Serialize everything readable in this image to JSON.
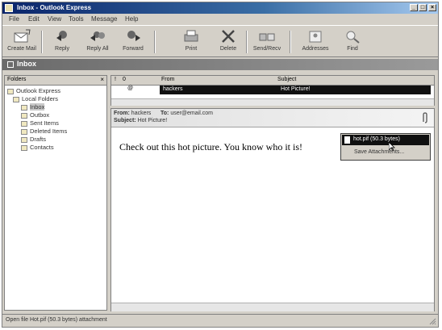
{
  "window": {
    "title": "Inbox - Outlook Express",
    "close_glyph": "×",
    "minimize_glyph": "_",
    "maximize_glyph": "□"
  },
  "menu": [
    "File",
    "Edit",
    "View",
    "Tools",
    "Message",
    "Help"
  ],
  "toolbar": [
    {
      "label": "Create Mail",
      "icon": "create-mail-icon"
    },
    {
      "label": "Reply",
      "icon": "reply-icon"
    },
    {
      "label": "Reply All",
      "icon": "reply-all-icon"
    },
    {
      "label": "Forward",
      "icon": "forward-icon"
    },
    {
      "label": "Print",
      "icon": "print-icon"
    },
    {
      "label": "Delete",
      "icon": "delete-icon"
    },
    {
      "label": "Send/Recv",
      "icon": "send-receive-icon"
    },
    {
      "label": "Addresses",
      "icon": "addresses-icon"
    },
    {
      "label": "Find",
      "icon": "find-icon"
    }
  ],
  "folder_bar": {
    "title": "Inbox"
  },
  "folders": {
    "header": "Folders",
    "close": "×",
    "items": [
      {
        "label": "Outlook Express",
        "level": 0
      },
      {
        "label": "Local Folders",
        "level": 1
      },
      {
        "label": "Inbox",
        "level": 2,
        "selected": true
      },
      {
        "label": "Outbox",
        "level": 2
      },
      {
        "label": "Sent Items",
        "level": 2
      },
      {
        "label": "Deleted Items",
        "level": 2
      },
      {
        "label": "Drafts",
        "level": 2
      },
      {
        "label": "Contacts",
        "level": 2
      }
    ]
  },
  "message_list": {
    "columns": [
      "!",
      "0",
      "From",
      "Subject"
    ],
    "rows": [
      {
        "from": "hackers",
        "subject": "Hot Picture!"
      }
    ]
  },
  "preview": {
    "from_label": "From:",
    "from": "hackers",
    "to_label": "To:",
    "to": "user@email.com",
    "subject_label": "Subject:",
    "subject": "Hot Picture!",
    "body": "Check out this hot picture. You know who it is!",
    "attachment_menu": {
      "file": "hot.pif (50.3 bytes)",
      "save": "Save Attachments..."
    }
  },
  "status": {
    "text": "Open file Hot.pif (50.3 bytes) attachment"
  }
}
